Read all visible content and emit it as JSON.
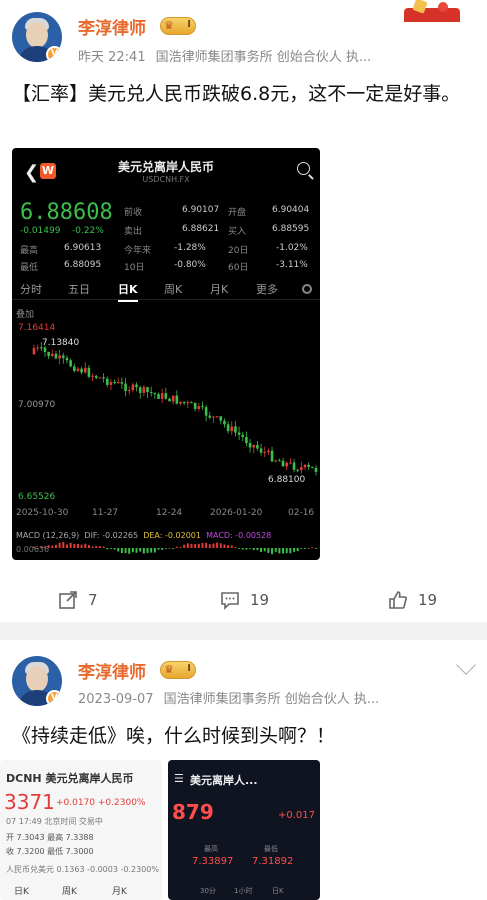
{
  "post1": {
    "username": "李淳律师",
    "level_badge": "I",
    "time": "昨天 22:41",
    "bio": "国浩律师集团事务所 创始合伙人 执...",
    "text": "【汇率】美元兑人民币跌破6.8元，这不一定是好事。",
    "actions": {
      "repost": "7",
      "comment": "19",
      "like": "19"
    },
    "colors": {
      "name": "#e8692b",
      "green": "#3bbf4b",
      "red": "#e23b3b"
    }
  },
  "stock_screenshot": {
    "back_icon": "chevron-left-icon",
    "title": "美元兑离岸人民币",
    "ticker": "USDCNH.FX",
    "price": "6.88608",
    "change": "-0.01499",
    "change_pct": "-0.22%",
    "quotes": [
      {
        "k": "前收",
        "v": "6.90107"
      },
      {
        "k": "开盘",
        "v": "6.90404"
      },
      {
        "k": "卖出",
        "v": "6.88621"
      },
      {
        "k": "买入",
        "v": "6.88595"
      },
      {
        "k": "最高",
        "v": "6.90613"
      },
      {
        "k": "今年来",
        "v": "-1.28%"
      },
      {
        "k": "20日",
        "v": "-1.02%"
      },
      {
        "k": "最低",
        "v": "6.88095"
      },
      {
        "k": "10日",
        "v": "-0.80%"
      },
      {
        "k": "60日",
        "v": "-3.11%"
      }
    ],
    "tabs": [
      "分时",
      "五日",
      "日K",
      "周K",
      "月K",
      "更多"
    ],
    "active_tab": "日K",
    "overlay_label": "叠加",
    "price_labels": {
      "high": "7.16414",
      "peak": "7.13840",
      "mid": "7.00970",
      "last": "6.88100",
      "low": "6.65526"
    },
    "x_dates": [
      "2025-10-30",
      "11-27",
      "12-24",
      "2026-01-20",
      "02-16"
    ],
    "macd": {
      "label": "MACD (12,26,9)",
      "dif": "DIF: -0.02265",
      "dea": "DEA: -0.02001",
      "macd": "MACD: -0.00528",
      "last": "0.00636"
    }
  },
  "post2": {
    "username": "李淳律师",
    "level_badge": "I",
    "time": "2023-09-07",
    "bio": "国浩律师集团事务所 创始合伙人 执...",
    "text": "《持续走低》唉，什么时候到头啊？！",
    "thumb1": {
      "title": "DCNH 美元兑离岸人民币",
      "price": "3371",
      "change": "+0.0170 +0.2300%",
      "time": "07 17:49 北京时间 交易中",
      "rows": [
        "开 7.3043  最高 7.3388",
        "收 7.3200  最低 7.3000"
      ],
      "footer": "人民币兑美元 0.1363 -0.0003 -0.2300%",
      "tabs": [
        "日K",
        "周K",
        "月K"
      ]
    },
    "thumb2": {
      "title": "美元离岸人...",
      "price": "879",
      "change": "+0.017",
      "hi_label": "最高",
      "hi": "7.33897",
      "lo_label": "最低",
      "lo": "7.31892",
      "tabs": [
        "30分",
        "1小时",
        "日K"
      ]
    }
  }
}
